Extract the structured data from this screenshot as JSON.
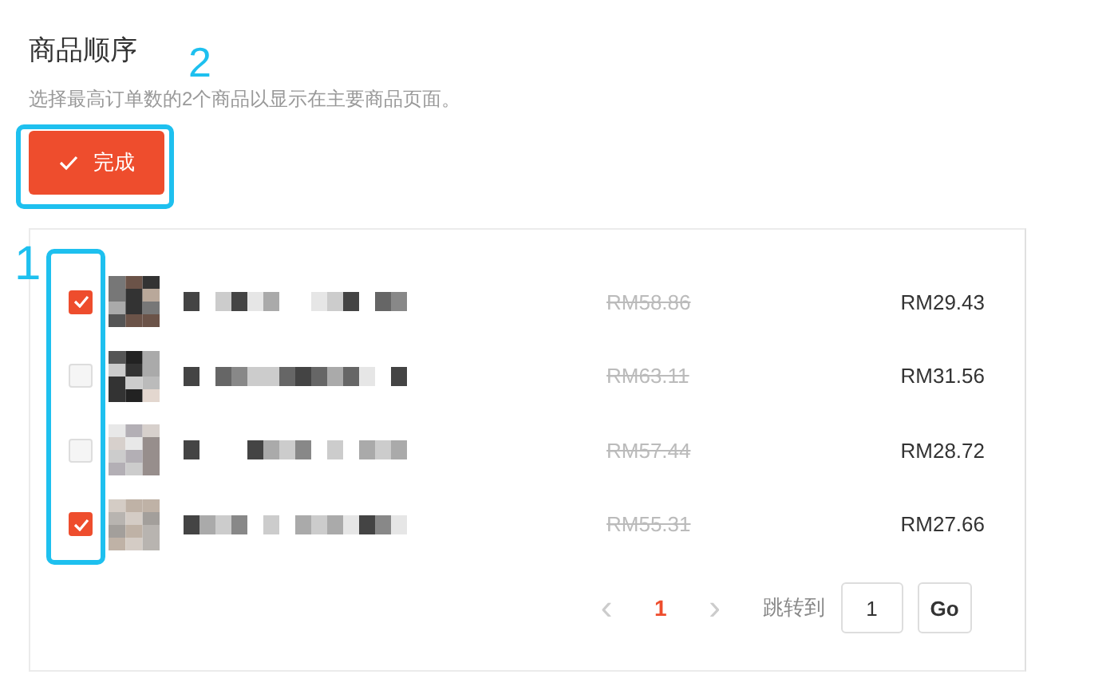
{
  "title": "商品顺序",
  "subtitle": "选择最高订单数的2个商品以显示在主要商品页面。",
  "done_button": {
    "label": "完成"
  },
  "products": [
    {
      "checked": true,
      "original_price": "RM58.86",
      "price": "RM29.43"
    },
    {
      "checked": false,
      "original_price": "RM63.11",
      "price": "RM31.56"
    },
    {
      "checked": false,
      "original_price": "RM57.44",
      "price": "RM28.72"
    },
    {
      "checked": true,
      "original_price": "RM55.31",
      "price": "RM27.66"
    }
  ],
  "pagination": {
    "prev": "‹",
    "pages": [
      {
        "label": "1",
        "selected": true
      }
    ],
    "next": "›",
    "jump_label": "跳转到",
    "jump_value": "1",
    "go": "Go"
  },
  "annotations": {
    "checkbox_frame": {
      "label": "1"
    },
    "button_frame": {
      "label": "2"
    }
  }
}
